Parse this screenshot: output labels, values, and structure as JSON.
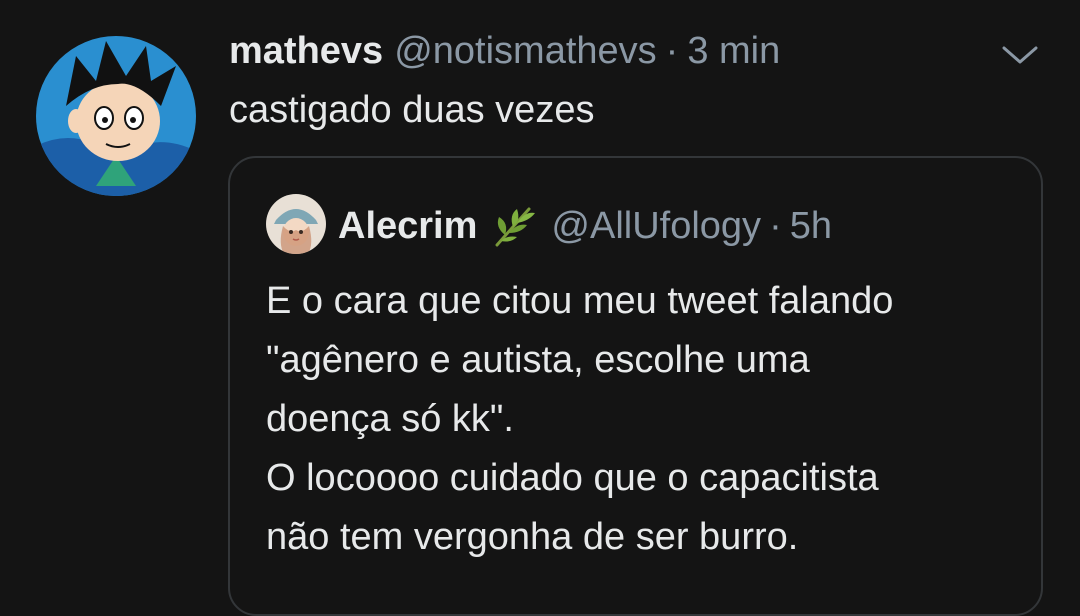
{
  "tweet": {
    "display_name": "mathevs",
    "handle": "@notismathevs",
    "separator": "·",
    "time": "3 min",
    "text": "castigado duas vezes",
    "avatar_icon": "cartoon-character-avatar",
    "menu_icon": "chevron-down-icon"
  },
  "quoted": {
    "display_name": "Alecrim",
    "emoji_icon": "herb-leaf-icon",
    "handle": "@AllUfology",
    "separator": "·",
    "time": "5h",
    "avatar_icon": "illustrated-person-avatar",
    "lines": [
      "E o cara que citou meu tweet falando",
      "\"agênero e autista, escolhe uma",
      "doença só kk\".",
      "O locoooo cuidado que o capacitista",
      "não tem vergonha de ser burro."
    ]
  },
  "colors": {
    "background": "#141414",
    "primary_text": "#e7e9ea",
    "secondary_text": "#8b98a5",
    "border": "#333639"
  }
}
